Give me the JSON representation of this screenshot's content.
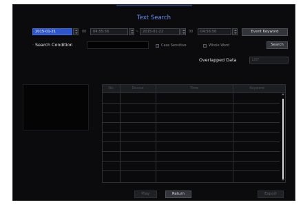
{
  "title": "Text Search",
  "search_row": {
    "start_date": "2015-01-21",
    "start_sep": "00",
    "start_time": "04:55:56",
    "range_sep": "~",
    "end_date": "2015-01-22",
    "end_sep": "00",
    "end_time": "04:56:56",
    "event_keyword_label": "Event Keyword"
  },
  "condition": {
    "label": "Search Condition",
    "value": "",
    "case_sensitive_label": "Case Sensitive",
    "whole_word_label": "Whole Word",
    "search_label": "Search"
  },
  "overlapped": {
    "label": "Overlapped Data",
    "value": "LIST"
  },
  "table": {
    "columns": [
      "No.",
      "Device",
      "Time",
      "Keyword"
    ]
  },
  "footer": {
    "play_label": "Play",
    "return_label": "Return",
    "export_label": "Export"
  }
}
